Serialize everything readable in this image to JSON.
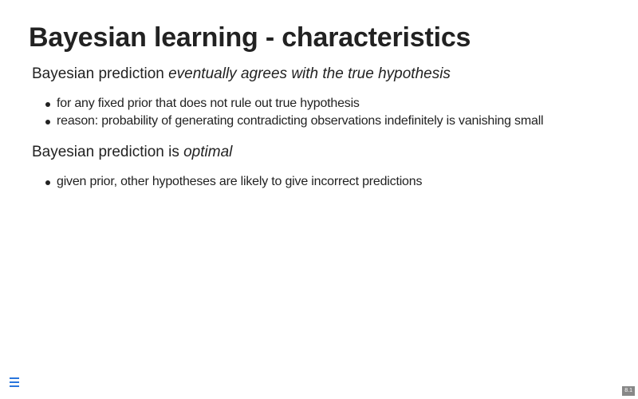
{
  "slide": {
    "title": "Bayesian learning - characteristics",
    "sections": [
      {
        "heading_plain": "Bayesian prediction ",
        "heading_emph": "eventually agrees with the true hypothesis",
        "bullets": [
          "for any fixed prior that does not rule out true hypothesis",
          "reason: probability of generating contradicting observations indefinitely is vanishing small"
        ]
      },
      {
        "heading_plain": "Bayesian prediction is ",
        "heading_emph": "optimal",
        "bullets": [
          "given prior, other hypotheses are likely to give incorrect predictions"
        ]
      }
    ]
  },
  "footer": {
    "menu_icon": "hamburger-menu-icon",
    "slide_number": "8.1",
    "accent_color": "#2a76dd"
  }
}
